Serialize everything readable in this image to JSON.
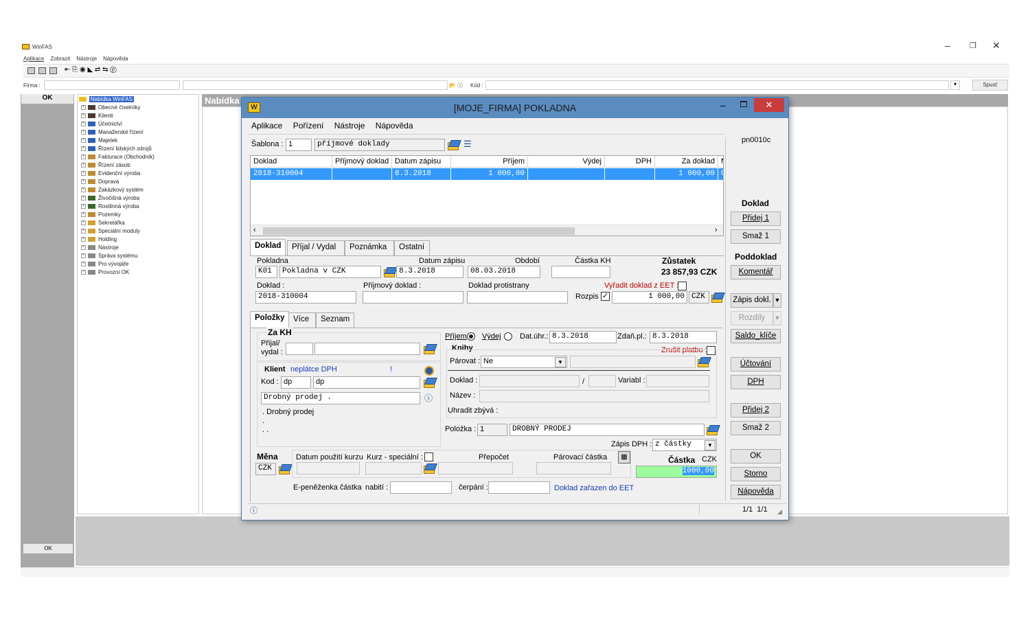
{
  "app": {
    "title": "WinFAS",
    "menu": [
      "Aplikace",
      "Zobrazit",
      "Nástroje",
      "Nápověda"
    ],
    "firma_label": "Firma :",
    "kod_label": "Kód :",
    "spust": "Spusť",
    "ok": "OK",
    "ok2": "OK",
    "bg_title": "Nabídka"
  },
  "tree": {
    "root": "Nabídka WinFAS",
    "items": [
      {
        "label": "Obecné číselníky",
        "color": "#4a3a30"
      },
      {
        "label": "Klienti",
        "color": "#4a3a30"
      },
      {
        "label": "Účetnictví",
        "color": "#2a62b8"
      },
      {
        "label": "Manažerské řízení",
        "color": "#2a62b8"
      },
      {
        "label": "Majetek",
        "color": "#2a62b8"
      },
      {
        "label": "Řízení lidských zdrojů",
        "color": "#2a62b8"
      },
      {
        "label": "Fakturace (Obchodník)",
        "color": "#c08a30"
      },
      {
        "label": "Řízení zásob",
        "color": "#c08a30"
      },
      {
        "label": "Evidenční výroba",
        "color": "#c08a30"
      },
      {
        "label": "Doprava",
        "color": "#c08a30"
      },
      {
        "label": "Zakázkový systém",
        "color": "#c08a30"
      },
      {
        "label": "Živočišná výroba",
        "color": "#3a6a2a"
      },
      {
        "label": "Rostlinná výroba",
        "color": "#3a6a2a"
      },
      {
        "label": "Pozemky",
        "color": "#c08a30"
      },
      {
        "label": "Sekretářka",
        "color": "#d0a030"
      },
      {
        "label": "Speciální moduly",
        "color": "#d0a030"
      },
      {
        "label": "Holding",
        "color": "#d0a030"
      },
      {
        "label": "Nástroje",
        "color": "#888"
      },
      {
        "label": "Správa systému",
        "color": "#888"
      },
      {
        "label": "Pro vývojáře",
        "color": "#888"
      },
      {
        "label": "Provozní OK",
        "color": "#888"
      }
    ]
  },
  "dialog": {
    "title": "[MOJE_FIRMA] POKLADNA",
    "menu": [
      "Aplikace",
      "Pořízení",
      "Nástroje",
      "Nápověda"
    ],
    "code": "pn0010c",
    "sablona_label": "Šablona :",
    "sablona_num": "1",
    "sablona_name": "příjmové doklady",
    "grid": {
      "headers": [
        "Doklad",
        "Příjmový doklad",
        "Datum zápisu",
        "Příjem",
        "Výdej",
        "DPH",
        "Za doklad",
        "M"
      ],
      "row": [
        "2018-310004",
        "",
        "8.3.2018",
        "1 000,00",
        "",
        "",
        "1 000,00",
        "C"
      ]
    },
    "tabs1": [
      "Doklad",
      "Příjal / Vydal",
      "Poznámka",
      "Ostatní"
    ],
    "pokladna_label": "Pokladna",
    "pokladna_code": "K01",
    "pokladna_name": "Pokladna v CZK",
    "datum_zapisu_label": "Datum zápisu",
    "datum_zapisu": "8.3.2018",
    "obdobi_label": "Období",
    "obdobi": "08.03.2018",
    "castka_kh_label": "Částka KH",
    "zustatek_label": "Zůstatek",
    "zustatek": "23 857,93 CZK",
    "doklad_label": "Doklad :",
    "doklad": "2018-310004",
    "prijmovy_label": "Příjmový doklad :",
    "protistrany_label": "Doklad protistrany",
    "vyradit_label": "Vyřadit doklad z EET :",
    "rozpis_label": "Rozpis",
    "rozpis_check": "✓",
    "rozpis_value": "1 000,00",
    "rozpis_cur": "CZK",
    "tabs2": [
      "Položky",
      "Více",
      "Seznam"
    ],
    "zakh_label": "Za KH",
    "prijal_label": "Přijal/",
    "vydal_label": "vydal :",
    "klient_label": "Klient",
    "neplatce": "neplátce DPH",
    "excl": "!",
    "kod_label": "Kod :",
    "kod1": "dp",
    "kod2": "dp",
    "klient_name": "Drobný prodej .",
    "klient_desc": ". Drobný prodej",
    "dot1": ".",
    "dot2": ". .",
    "prijem_label": "Příjem",
    "vydej_label": "Výdej",
    "datuhr_label": "Dat.úhr.:",
    "datuhr": "8.3.2018",
    "zdanpl_label": "Zdaň.pl.:",
    "zdanpl": "8.3.2018",
    "knihy_label": "Knihy",
    "zrusit_label": "Zrušit platbu :",
    "parovat_label": "Párovat :",
    "parovat_value": "Ne",
    "doklad2_label": "Doklad :",
    "slash": "/",
    "variabl_label": "Variabl :",
    "nazev_label": "Název :",
    "uhradit_label": "Uhradit zbývá :",
    "polozka_label": "Položka :",
    "polozka_num": "1",
    "polozka_name": "DROBNÝ PRODEJ",
    "zapis_dph_label": "Zápis DPH :",
    "zapis_dph_value": "z částky",
    "mena_label": "Měna",
    "mena": "CZK",
    "datum_kurzu_label": "Datum použití kurzu",
    "kurz_label": "Kurz - speciální :",
    "prepocet_label": "Přepočet",
    "parovaci_label": "Párovací částka",
    "castka_label": "Částka",
    "castka_cur": "CZK",
    "castka_value": "1000,00",
    "epen_label": "E-peněženka částka",
    "nabiti_label": "nabití :",
    "cerpani_label": "čerpání :",
    "eet_status": "Doklad zařazen do EET",
    "status_pos": "1/1  1/1",
    "side": {
      "doklad_hdr": "Doklad",
      "pridej1": "Přidej 1",
      "smaz1": "Smaž 1",
      "poddoklad_hdr": "Poddoklad",
      "komentar": "Komentář",
      "zapis_dokl": "Zápis dokl.",
      "rozdily": "Rozdíly",
      "saldo": "Saldo_klíče",
      "uctovani": "Účtování",
      "dph": "DPH",
      "pridej2": "Přidej 2",
      "smaz2": "Smaž 2",
      "ok": "OK",
      "storno": "Storno",
      "napoveda": "Nápověda"
    }
  },
  "colors": {
    "titlebar": "#5a8cc0",
    "close": "#c83c3c",
    "highlight": "#3399ff",
    "green": "#9dfa9d"
  }
}
